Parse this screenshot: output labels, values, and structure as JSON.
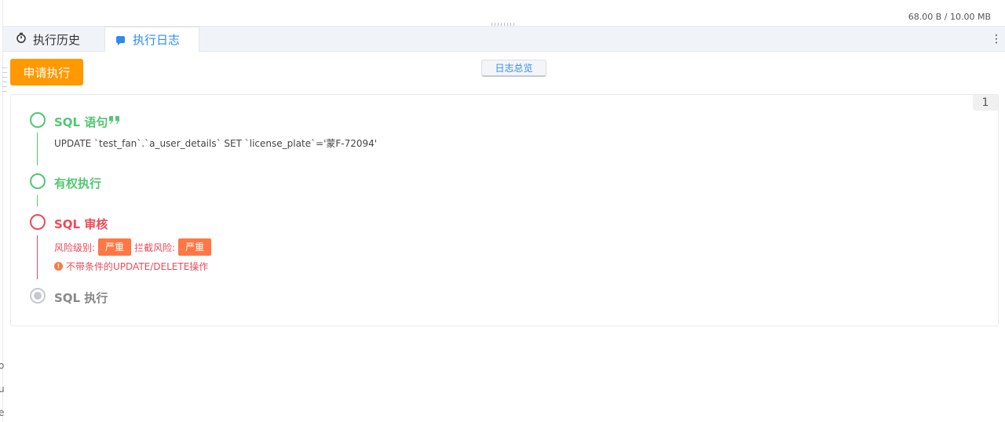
{
  "header": {
    "size_info": "68.00 B / 10.00 MB"
  },
  "tabs": [
    {
      "label": "执行历史",
      "icon": "stopwatch-icon",
      "active": false
    },
    {
      "label": "执行日志",
      "icon": "chat-icon",
      "active": true
    }
  ],
  "toolbar": {
    "apply_label": "申请执行",
    "overview_label": "日志总览"
  },
  "panel": {
    "page_badge": "1"
  },
  "steps": [
    {
      "title": "SQL 语句",
      "status": "success",
      "sql": "UPDATE `test_fan`.`a_user_details` SET `license_plate`='蒙F-72094'"
    },
    {
      "title": "有权执行",
      "status": "success"
    },
    {
      "title": "SQL 审核",
      "status": "error",
      "risk_level_label": "风险级别:",
      "risk_level_value": "严重",
      "intercept_label": "拦截风险:",
      "intercept_value": "严重",
      "warning": "不带条件的UPDATE/DELETE操作"
    },
    {
      "title": "SQL 执行",
      "status": "pending"
    }
  ],
  "left_edge_chars": [
    "o",
    "u",
    "e"
  ],
  "colors": {
    "success": "#52c773",
    "error": "#ed4958",
    "primary": "#2d8cf0",
    "apply_button": "#ff9900",
    "tag": "#ff7744"
  }
}
